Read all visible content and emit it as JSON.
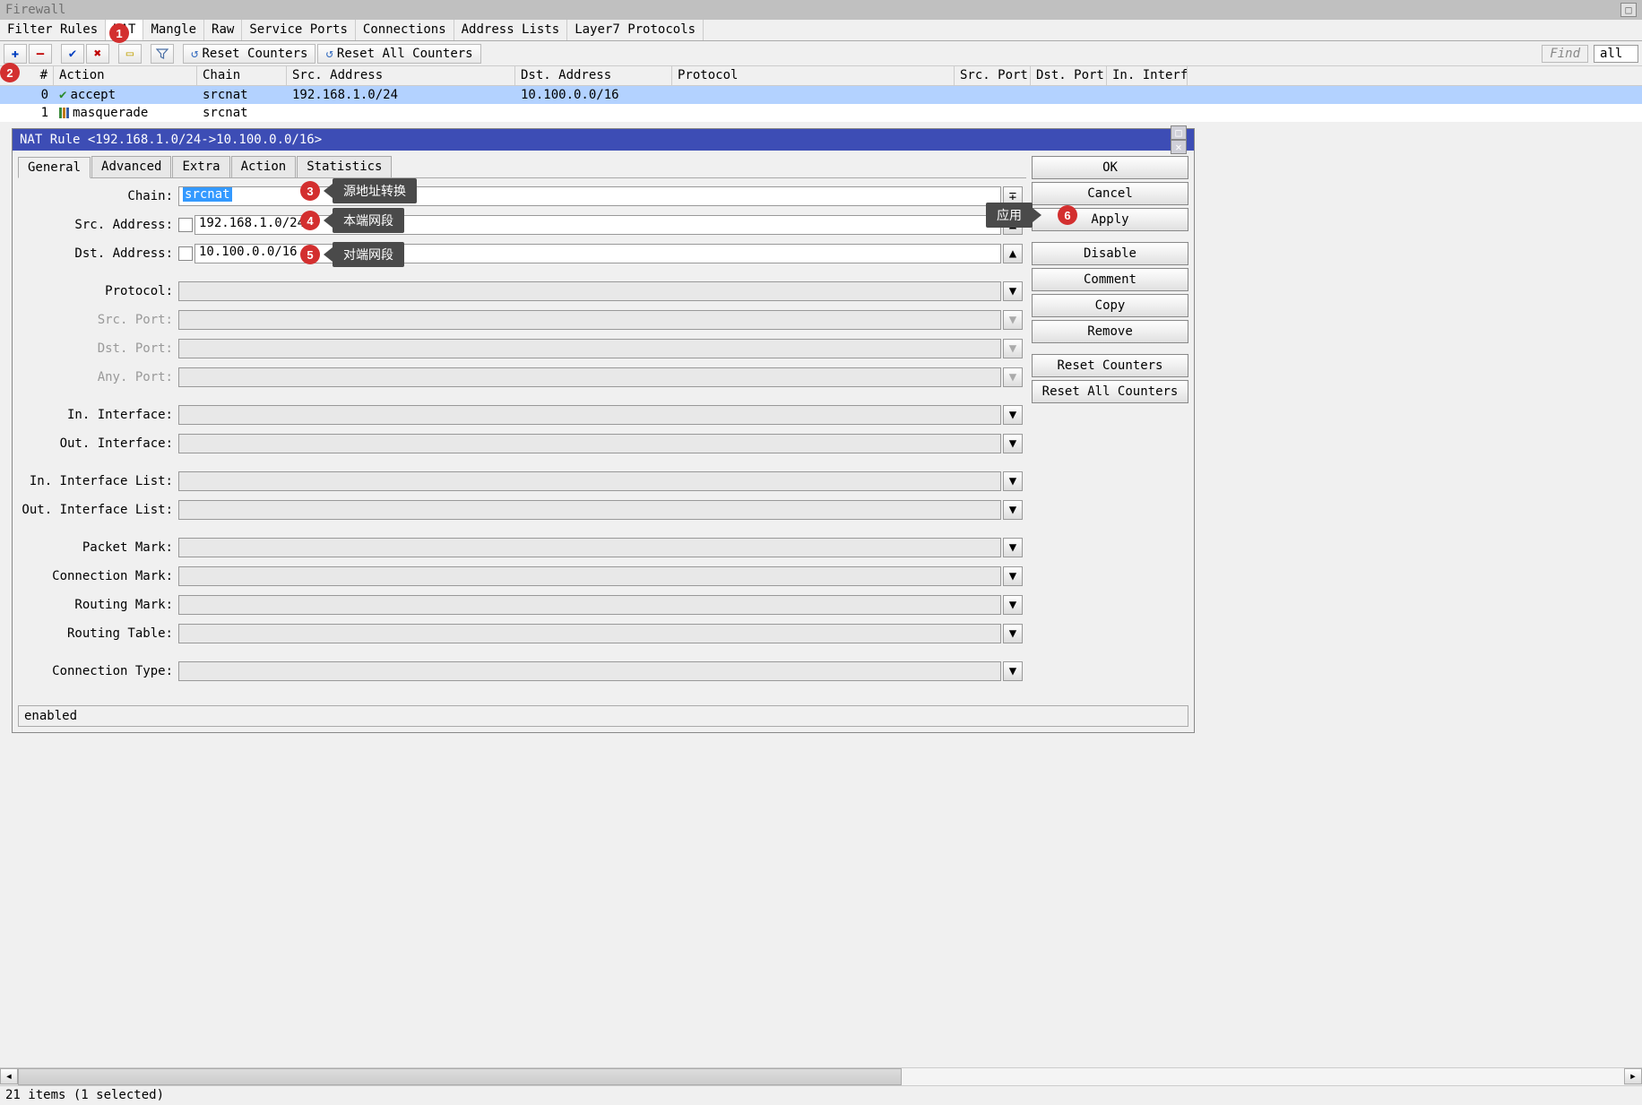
{
  "window": {
    "title": "Firewall"
  },
  "tabs": [
    "Filter Rules",
    "NAT",
    "Mangle",
    "Raw",
    "Service Ports",
    "Connections",
    "Address Lists",
    "Layer7 Protocols"
  ],
  "active_tab": 1,
  "toolbar": {
    "reset_counters": "Reset Counters",
    "reset_all_counters": "Reset All Counters",
    "find": "Find",
    "filter": "all"
  },
  "columns": [
    "#",
    "Action",
    "Chain",
    "Src. Address",
    "Dst. Address",
    "Protocol",
    "Src. Port",
    "Dst. Port",
    "In. Interfa"
  ],
  "rows": [
    {
      "idx": "0",
      "action": "accept",
      "chain": "srcnat",
      "src": "192.168.1.0/24",
      "dst": "10.100.0.0/16",
      "selected": true,
      "icon": "check"
    },
    {
      "idx": "1",
      "action": "masquerade",
      "chain": "srcnat",
      "src": "",
      "dst": "",
      "selected": false,
      "icon": "masq"
    }
  ],
  "dialog": {
    "title": "NAT Rule <192.168.1.0/24->10.100.0.0/16>",
    "tabs": [
      "General",
      "Advanced",
      "Extra",
      "Action",
      "Statistics"
    ],
    "active_tab": 0,
    "fields": {
      "chain_label": "Chain:",
      "chain_value": "srcnat",
      "src_addr_label": "Src. Address:",
      "src_addr_value": "192.168.1.0/24",
      "dst_addr_label": "Dst. Address:",
      "dst_addr_value": "10.100.0.0/16",
      "protocol_label": "Protocol:",
      "src_port_label": "Src. Port:",
      "dst_port_label": "Dst. Port:",
      "any_port_label": "Any. Port:",
      "in_iface_label": "In. Interface:",
      "out_iface_label": "Out. Interface:",
      "in_iface_list_label": "In. Interface List:",
      "out_iface_list_label": "Out. Interface List:",
      "packet_mark_label": "Packet Mark:",
      "conn_mark_label": "Connection Mark:",
      "routing_mark_label": "Routing Mark:",
      "routing_table_label": "Routing Table:",
      "conn_type_label": "Connection Type:"
    },
    "buttons": {
      "ok": "OK",
      "cancel": "Cancel",
      "apply": "Apply",
      "disable": "Disable",
      "comment": "Comment",
      "copy": "Copy",
      "remove": "Remove",
      "reset_counters": "Reset Counters",
      "reset_all_counters": "Reset All Counters"
    },
    "status": "enabled"
  },
  "annotations": {
    "a1": "1",
    "a2": "2",
    "a3": "3",
    "a4": "4",
    "a5": "5",
    "a6": "6",
    "l3": "源地址转换",
    "l4": "本端网段",
    "l5": "对端网段",
    "l6": "应用"
  },
  "statusbar": "21 items (1 selected)"
}
